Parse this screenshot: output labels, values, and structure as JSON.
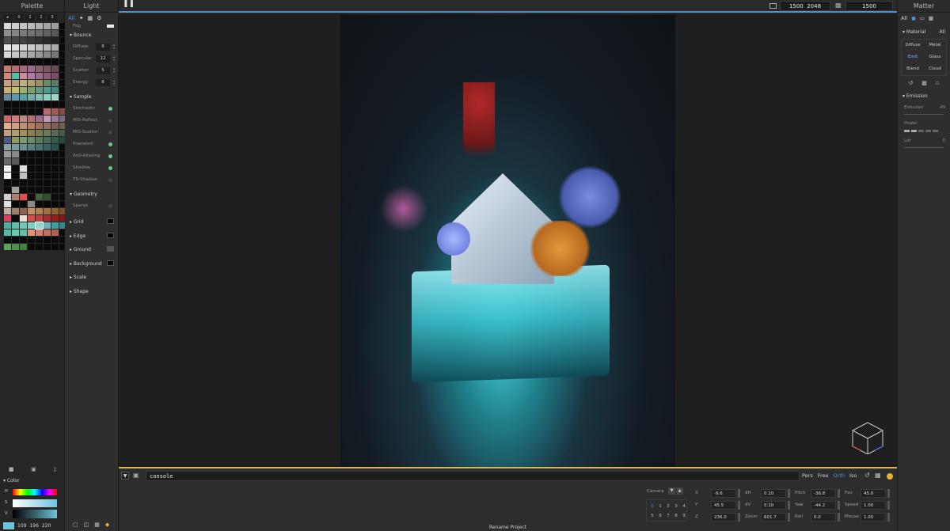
{
  "palette": {
    "title": "Palette",
    "tabs": [
      "▸",
      "0",
      "1",
      "2",
      "3"
    ],
    "swatches": [
      "#d8d8d8",
      "#cfcfcf",
      "#c4c4c4",
      "#bbbbbb",
      "#b0b0b0",
      "#a6a6a6",
      "#9c9c9c",
      "#0a0a0a",
      "#8f8f8f",
      "#858585",
      "#7c7c7c",
      "#737373",
      "#6a6a6a",
      "#616161",
      "#585858",
      "#0a0a0a",
      "#4f4f4f",
      "#474747",
      "#3f3f3f",
      "#373737",
      "#303030",
      "#292929",
      "#222222",
      "#0a0a0a",
      "#e8e8e8",
      "#dedede",
      "#d4d4d4",
      "#cacaca",
      "#bfbfbf",
      "#b5b5b5",
      "#aaaaaa",
      "#0a0a0a",
      "#d8d8d8",
      "#c8c8c8",
      "#b8b8b8",
      "#a8a8a8",
      "#989898",
      "#888888",
      "#787878",
      "#0a0a0a",
      "#0a0a0a",
      "#0a0a0a",
      "#0a0a0a",
      "#0a0a0a",
      "#0a0a0a",
      "#0a0a0a",
      "#0a0a0a",
      "#0a0a0a",
      "#c87a6e",
      "#b56d6d",
      "#a86a7a",
      "#9a6a88",
      "#8a5f6e",
      "#7a5560",
      "#6a4a52",
      "#0a0a0a",
      "#d08a7c",
      "#55c0a8",
      "#c98aa0",
      "#b07ba0",
      "#a06a8a",
      "#8f5a78",
      "#7c4b66",
      "#0a0a0a",
      "#c8a08a",
      "#b89a80",
      "#c0b080",
      "#b0a070",
      "#a09060",
      "#6a8a6a",
      "#5a7a6a",
      "#0a0a0a",
      "#d0b070",
      "#c0c070",
      "#a0b070",
      "#80a070",
      "#609a80",
      "#509a8a",
      "#408a80",
      "#0a0a0a",
      "#6a8aa0",
      "#5a9ab0",
      "#5aa0a8",
      "#70b0a8",
      "#80c0b0",
      "#90d0c0",
      "#a0d8c8",
      "#0a0a0a",
      "#0a0a0a",
      "#0a0a0a",
      "#0a0a0a",
      "#0a0a0a",
      "#0a0a0a",
      "#0a0a0a",
      "#0a0a0a",
      "#0a0a0a",
      "#0a0a0a",
      "#0a0a0a",
      "#0a0a0a",
      "#0a0a0a",
      "#0a0a0a",
      "#b86a6a",
      "#a05a5a",
      "#8a4a4a",
      "#c86a6a",
      "#d08080",
      "#c08a8a",
      "#b07070",
      "#a06a8a",
      "#c09ab0",
      "#9a7a9a",
      "#7a6a7a",
      "#e0b090",
      "#d0a080",
      "#c09070",
      "#b08060",
      "#a07050",
      "#907060",
      "#806050",
      "#706050",
      "#c0a080",
      "#b0a070",
      "#a09060",
      "#8a8050",
      "#7a7a50",
      "#6a7a5a",
      "#5a6a5a",
      "#4a5a4a",
      "#4a5a8a",
      "#8a9a60",
      "#7a9a70",
      "#6a8a6a",
      "#5a7a60",
      "#4a6a5a",
      "#3a5a4a",
      "#2a4a3a",
      "#8aa0a0",
      "#7a9aa0",
      "#6a9090",
      "#5a8080",
      "#4a7070",
      "#3a6060",
      "#2a5050",
      "#0a0a0a",
      "#9a9a9a",
      "#8a8a8a",
      "#0a0a0a",
      "#0a0a0a",
      "#0a0a0a",
      "#0a0a0a",
      "#0a0a0a",
      "#0a0a0a",
      "#6a6a6a",
      "#5a5a5a",
      "#0a0a0a",
      "#0a0a0a",
      "#0a0a0a",
      "#0a0a0a",
      "#0a0a0a",
      "#0a0a0a",
      "#f0f0f0",
      "#0a0a0a",
      "#e0e0e0",
      "#0a0a0a",
      "#0a0a0a",
      "#0a0a0a",
      "#0a0a0a",
      "#0a0a0a",
      "#ffffff",
      "#0a0a0a",
      "#c0c0c0",
      "#0a0a0a",
      "#0a0a0a",
      "#0a0a0a",
      "#0a0a0a",
      "#0a0a0a",
      "#0a0a0a",
      "#0a0a0a",
      "#0a0a0a",
      "#0a0a0a",
      "#0a0a0a",
      "#0a0a0a",
      "#0a0a0a",
      "#0a0a0a",
      "#0a0a0a",
      "#a0a0a0",
      "#0a0a0a",
      "#0a0a0a",
      "#0a0a0a",
      "#0a0a0a",
      "#0a0a0a",
      "#0a0a0a",
      "#d0d0d0",
      "#b08070",
      "#e05050",
      "#0a0a0a",
      "#406040",
      "#305030",
      "#0a0a0a",
      "#0a0a0a",
      "#e0e0e0",
      "#0a0a0a",
      "#0a0a0a",
      "#8a8a8a",
      "#0a0a0a",
      "#0a0a0a",
      "#0a0a0a",
      "#0a0a0a",
      "#c0b0a0",
      "#a08070",
      "#906050",
      "#c09060",
      "#b08050",
      "#a07040",
      "#906030",
      "#805020",
      "#e04060",
      "#0a0a0a",
      "#e8e0d0",
      "#d05050",
      "#c04040",
      "#a03030",
      "#902020",
      "#801818",
      "#50b0a0",
      "#60c0b0",
      "#70c8b8",
      "#80d0c0",
      "#90d8c8",
      "#70b0c0",
      "#40a0a0",
      "#308888",
      "#58b8a8",
      "#68c8b0",
      "#60c0a8",
      "#e09080",
      "#d08070",
      "#c07060",
      "#b06050",
      "#0a0a0a",
      "#0a0a0a",
      "#0a0a0a",
      "#0a0a0a",
      "#0a0a0a",
      "#0a0a0a",
      "#0a0a0a",
      "#0a0a0a",
      "#0a0a0a",
      "#60a060",
      "#509050",
      "#408040",
      "#0a0a0a",
      "#0a0a0a",
      "#0a0a0a",
      "#0a0a0a",
      "#0a0a0a"
    ],
    "selected_index": 228,
    "color_section": "Color",
    "h_label": "H",
    "s_label": "S",
    "v_label": "V",
    "r": "109",
    "g": "196",
    "b": "220"
  },
  "light": {
    "title": "Light",
    "tab_all": "All",
    "fog_label": "Fog",
    "bounce": {
      "title": "Bounce",
      "rows": [
        {
          "label": "Diffuse",
          "value": "8"
        },
        {
          "label": "Specular",
          "value": "12"
        },
        {
          "label": "Scatter",
          "value": "5"
        },
        {
          "label": "Energy",
          "value": "8"
        }
      ]
    },
    "sample": {
      "title": "Sample",
      "rows": [
        {
          "label": "Stochastic",
          "on": true
        },
        {
          "label": "MIS-Reflect",
          "on": false
        },
        {
          "label": "MIS-Scatter",
          "on": false
        },
        {
          "label": "Pixelated",
          "on": true
        },
        {
          "label": "Anti-Aliasing",
          "on": true
        },
        {
          "label": "Shadow",
          "on": true
        },
        {
          "label": "TR-Shadow",
          "on": false
        }
      ]
    },
    "geometry": {
      "title": "Geometry",
      "sparse": "Sparse"
    },
    "collapsed": [
      {
        "label": "Grid",
        "color": "#050505"
      },
      {
        "label": "Edge",
        "color": "#050505"
      },
      {
        "label": "Ground",
        "color": "#555555"
      },
      {
        "label": "Background",
        "color": "#050505"
      },
      {
        "label": "Scale",
        "color": ""
      },
      {
        "label": "Shape",
        "color": ""
      }
    ]
  },
  "topbar": {
    "width": "1500",
    "height": "2048",
    "samples": "1500"
  },
  "matter": {
    "title": "Matter",
    "tab_all": "All",
    "material_title": "Material",
    "material_all": "All",
    "materials": [
      "Diffuse",
      "Metal",
      "Emit",
      "Glass",
      "Blend",
      "Cloud"
    ],
    "active_material": "Emit",
    "emission_title": "Emission",
    "emission_label": "Emission",
    "emission_value": "49",
    "power_label": "Power",
    "ldr_label": "Ldr",
    "ldr_value": "0"
  },
  "console": {
    "placeholder": "console",
    "modes": [
      "Pers",
      "Free",
      "Orth",
      "Iso"
    ],
    "active_mode": "Orth"
  },
  "camera": {
    "label": "Camera",
    "slots": [
      "0",
      "1",
      "2",
      "3",
      "4",
      "5",
      "6",
      "7",
      "8",
      "9"
    ],
    "fields": [
      {
        "label": "X",
        "value": "-9.6"
      },
      {
        "label": "Y",
        "value": "45.5"
      },
      {
        "label": "Z",
        "value": "236.0"
      },
      {
        "label": "dH",
        "value": "0.10"
      },
      {
        "label": "dV",
        "value": "0.10"
      },
      {
        "label": "Zoom",
        "value": "601.7"
      },
      {
        "label": "Pitch",
        "value": "-36.8"
      },
      {
        "label": "Yaw",
        "value": "-44.2"
      },
      {
        "label": "Roll",
        "value": "0.0"
      },
      {
        "label": "Fov",
        "value": "45.0"
      },
      {
        "label": "Speed",
        "value": "1.00"
      },
      {
        "label": "Mouse",
        "value": "1.00"
      }
    ]
  },
  "footer": {
    "rename": "Rename Project"
  },
  "colors": {
    "accent": "#4a90d9",
    "console_border": "#e0b44a",
    "emit": "#6ec3ff",
    "selected_swatch": "#6dc4dc"
  }
}
